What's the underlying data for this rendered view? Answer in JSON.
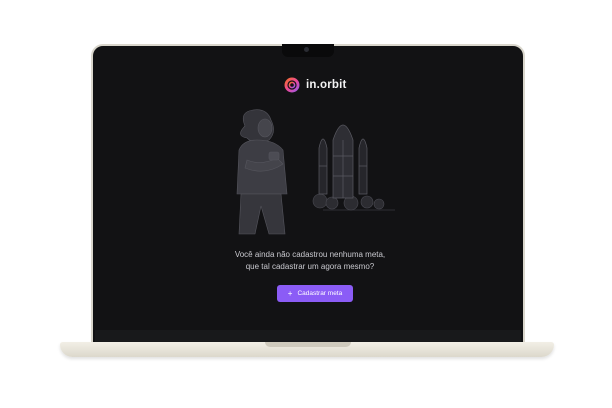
{
  "app": {
    "name": "in.orbit"
  },
  "empty_state": {
    "line1": "Você ainda não cadastrou nenhuma meta,",
    "line2": "que tal cadastrar um agora mesmo?"
  },
  "cta": {
    "icon": "plus-icon",
    "label": "Cadastrar meta"
  },
  "colors": {
    "accent": "#8b5cf6",
    "background": "#121214",
    "text": "#c9c9cf",
    "laptop_shell": "#ece9df"
  }
}
